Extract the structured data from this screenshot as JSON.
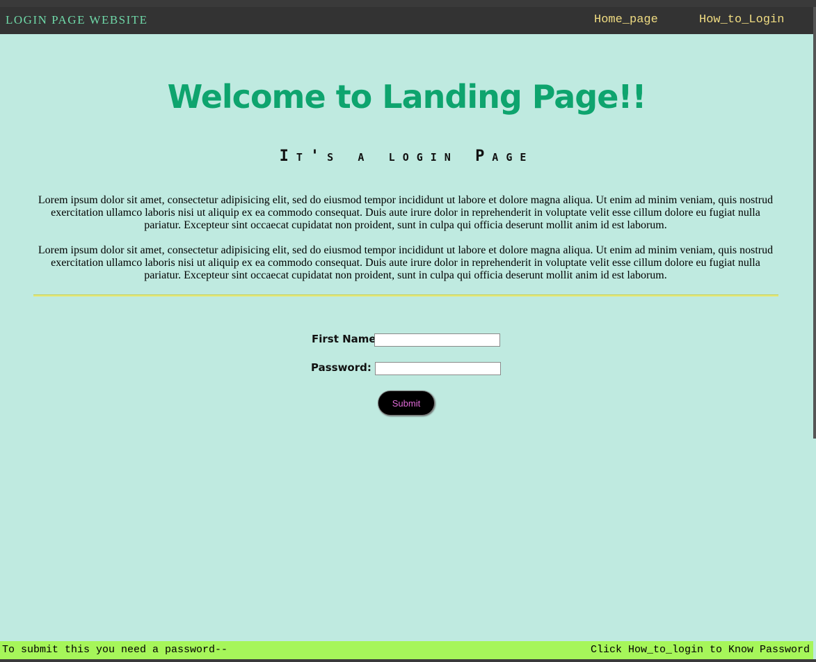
{
  "navbar": {
    "brand": "LOGIN PAGE WEBSITE",
    "links": [
      "Home_page",
      "How_to_Login"
    ]
  },
  "header": {
    "title": "Welcome to Landing Page!!",
    "subtitle": "It's a login Page"
  },
  "paragraphs": [
    "Lorem ipsum dolor sit amet, consectetur adipisicing elit, sed do eiusmod tempor incididunt ut labore et dolore magna aliqua. Ut enim ad minim veniam, quis nostrud exercitation ullamco laboris nisi ut aliquip ex ea commodo consequat. Duis aute irure dolor in reprehenderit in voluptate velit esse cillum dolore eu fugiat nulla pariatur. Excepteur sint occaecat cupidatat non proident, sunt in culpa qui officia deserunt mollit anim id est laborum.",
    "Lorem ipsum dolor sit amet, consectetur adipisicing elit, sed do eiusmod tempor incididunt ut labore et dolore magna aliqua. Ut enim ad minim veniam, quis nostrud exercitation ullamco laboris nisi ut aliquip ex ea commodo consequat. Duis aute irure dolor in reprehenderit in voluptate velit esse cillum dolore eu fugiat nulla pariatur. Excepteur sint occaecat cupidatat non proident, sunt in culpa qui officia deserunt mollit anim id est laborum."
  ],
  "form": {
    "first_name_label": "First Name:",
    "first_name_value": "",
    "password_label": "Password:",
    "password_value": "",
    "submit_label": "Submit"
  },
  "footer": {
    "left_text": "To submit this you need a password--",
    "right_text": "Click How_to_login to Know Password"
  },
  "colors": {
    "background": "#bfeae0",
    "navbar": "#333333",
    "brand": "#6fd8a8",
    "nav_link": "#f0dc82",
    "title": "#0ea46e",
    "footer": "#a6f65a",
    "submit_bg": "#000000",
    "submit_text": "#e06ad8"
  }
}
